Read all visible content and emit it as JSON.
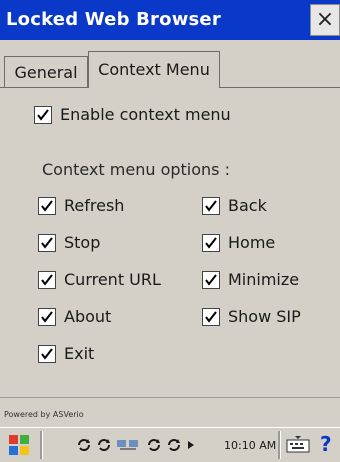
{
  "window": {
    "title": "Locked Web Browser",
    "close_glyph": "×"
  },
  "tabs": [
    {
      "label": "General",
      "active": false
    },
    {
      "label": "Context Menu",
      "active": true
    }
  ],
  "enable_context_menu": {
    "label": "Enable context menu",
    "checked": true
  },
  "options_heading": "Context menu options :",
  "options": [
    {
      "label": "Refresh",
      "checked": true
    },
    {
      "label": "Back",
      "checked": true
    },
    {
      "label": "Stop",
      "checked": true
    },
    {
      "label": "Home",
      "checked": true
    },
    {
      "label": "Current URL",
      "checked": true
    },
    {
      "label": "Minimize",
      "checked": true
    },
    {
      "label": "About",
      "checked": true
    },
    {
      "label": "Show SIP",
      "checked": true
    },
    {
      "label": "Exit",
      "checked": true
    }
  ],
  "footer": {
    "powered_by": "Powered by ASVerio"
  },
  "taskbar": {
    "clock": "10:10 AM",
    "icons": [
      "start-icon",
      "sync-icon",
      "sync-icon",
      "network-icon",
      "sync-icon",
      "sync-icon",
      "keyboard-icon",
      "help-icon"
    ],
    "accent": "#0a38c8"
  }
}
